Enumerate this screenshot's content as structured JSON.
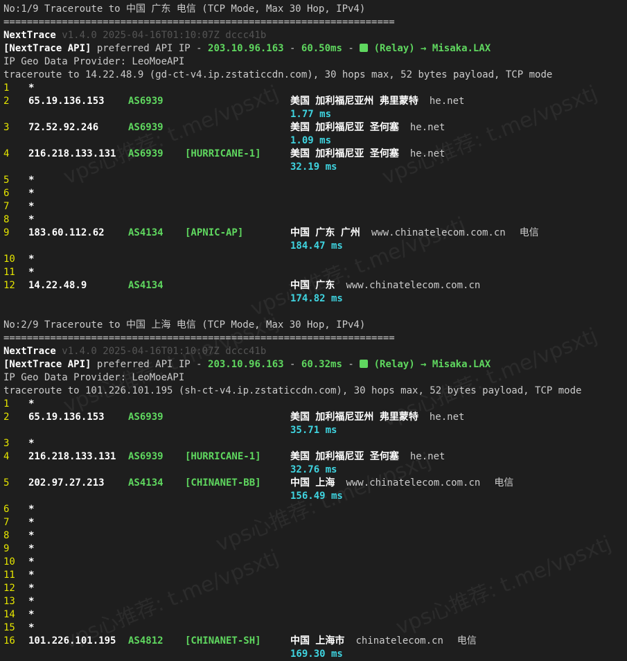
{
  "watermark": "vps心推荐: t.me/vpsxtj",
  "sections": [
    {
      "header": "No:1/9 Traceroute to 中国 广东 电信 (TCP Mode, Max 30 Hop, IPv4)",
      "separator": "===================================================================",
      "nt_name": "NextTrace",
      "nt_version": " v1.4.0 2025-04-16T01:10:07Z dccc41b",
      "api_label": "[NextTrace API]",
      "api_text": " preferred API IP - ",
      "api_ip": "203.10.96.163",
      "api_dash": " - ",
      "api_ms": "60.50ms",
      "api_dash2": " - ",
      "api_relay": " (Relay) → Misaka.LAX",
      "geo_provider": "IP Geo Data Provider: LeoMoeAPI",
      "trace_line": "traceroute to 14.22.48.9 (gd-ct-v4.ip.zstaticcdn.com), 30 hops max, 52 bytes payload, TCP mode",
      "hops": [
        {
          "n": "1",
          "ip": "*"
        },
        {
          "n": "2",
          "ip": "65.19.136.153",
          "as": "AS6939",
          "tag": "",
          "geo": "美国 加利福尼亚州 弗里蒙特",
          "host": "he.net",
          "isp": "",
          "ms": "1.77 ms"
        },
        {
          "n": "3",
          "ip": "72.52.92.246",
          "as": "AS6939",
          "tag": "",
          "geo": "美国 加利福尼亚 圣何塞",
          "host": "he.net",
          "isp": "",
          "ms": "1.09 ms"
        },
        {
          "n": "4",
          "ip": "216.218.133.131",
          "as": "AS6939",
          "tag": "[HURRICANE-1]",
          "geo": "美国 加利福尼亚 圣何塞",
          "host": "he.net",
          "isp": "",
          "ms": "32.19 ms"
        },
        {
          "n": "5",
          "ip": "*"
        },
        {
          "n": "6",
          "ip": "*"
        },
        {
          "n": "7",
          "ip": "*"
        },
        {
          "n": "8",
          "ip": "*"
        },
        {
          "n": "9",
          "ip": "183.60.112.62",
          "as": "AS4134",
          "tag": "[APNIC-AP]",
          "geo": "中国 广东 广州",
          "host": "www.chinatelecom.com.cn",
          "isp": "电信",
          "ms": "184.47 ms"
        },
        {
          "n": "10",
          "ip": "*"
        },
        {
          "n": "11",
          "ip": "*"
        },
        {
          "n": "12",
          "ip": "14.22.48.9",
          "as": "AS4134",
          "tag": "",
          "geo": "中国 广东",
          "host": "www.chinatelecom.com.cn",
          "isp": "",
          "ms": "174.82 ms"
        }
      ]
    },
    {
      "header": "No:2/9 Traceroute to 中国 上海 电信 (TCP Mode, Max 30 Hop, IPv4)",
      "separator": "===================================================================",
      "nt_name": "NextTrace",
      "nt_version": " v1.4.0 2025-04-16T01:10:07Z dccc41b",
      "api_label": "[NextTrace API]",
      "api_text": " preferred API IP - ",
      "api_ip": "203.10.96.163",
      "api_dash": " - ",
      "api_ms": "60.32ms",
      "api_dash2": " - ",
      "api_relay": " (Relay) → Misaka.LAX",
      "geo_provider": "IP Geo Data Provider: LeoMoeAPI",
      "trace_line": "traceroute to 101.226.101.195 (sh-ct-v4.ip.zstaticcdn.com), 30 hops max, 52 bytes payload, TCP mode",
      "hops": [
        {
          "n": "1",
          "ip": "*"
        },
        {
          "n": "2",
          "ip": "65.19.136.153",
          "as": "AS6939",
          "tag": "",
          "geo": "美国 加利福尼亚州 弗里蒙特",
          "host": "he.net",
          "isp": "",
          "ms": "35.71 ms"
        },
        {
          "n": "3",
          "ip": "*"
        },
        {
          "n": "4",
          "ip": "216.218.133.131",
          "as": "AS6939",
          "tag": "[HURRICANE-1]",
          "geo": "美国 加利福尼亚 圣何塞",
          "host": "he.net",
          "isp": "",
          "ms": "32.76 ms"
        },
        {
          "n": "5",
          "ip": "202.97.27.213",
          "as": "AS4134",
          "tag": "[CHINANET-BB]",
          "geo": "中国 上海",
          "host": "www.chinatelecom.com.cn",
          "isp": "电信",
          "ms": "156.49 ms"
        },
        {
          "n": "6",
          "ip": "*"
        },
        {
          "n": "7",
          "ip": "*"
        },
        {
          "n": "8",
          "ip": "*"
        },
        {
          "n": "9",
          "ip": "*"
        },
        {
          "n": "10",
          "ip": "*"
        },
        {
          "n": "11",
          "ip": "*"
        },
        {
          "n": "12",
          "ip": "*"
        },
        {
          "n": "13",
          "ip": "*"
        },
        {
          "n": "14",
          "ip": "*"
        },
        {
          "n": "15",
          "ip": "*"
        },
        {
          "n": "16",
          "ip": "101.226.101.195",
          "as": "AS4812",
          "tag": "[CHINANET-SH]",
          "geo": "中国 上海市",
          "host": "chinatelecom.cn",
          "isp": "电信",
          "ms": "169.30 ms"
        }
      ]
    }
  ],
  "colors": {
    "asn": "#5fd75f",
    "latency": "#3fd4e0",
    "hop_number": "#e5e500",
    "background": "#1e1e1e"
  },
  "icons": {
    "relay": "relay-icon"
  }
}
